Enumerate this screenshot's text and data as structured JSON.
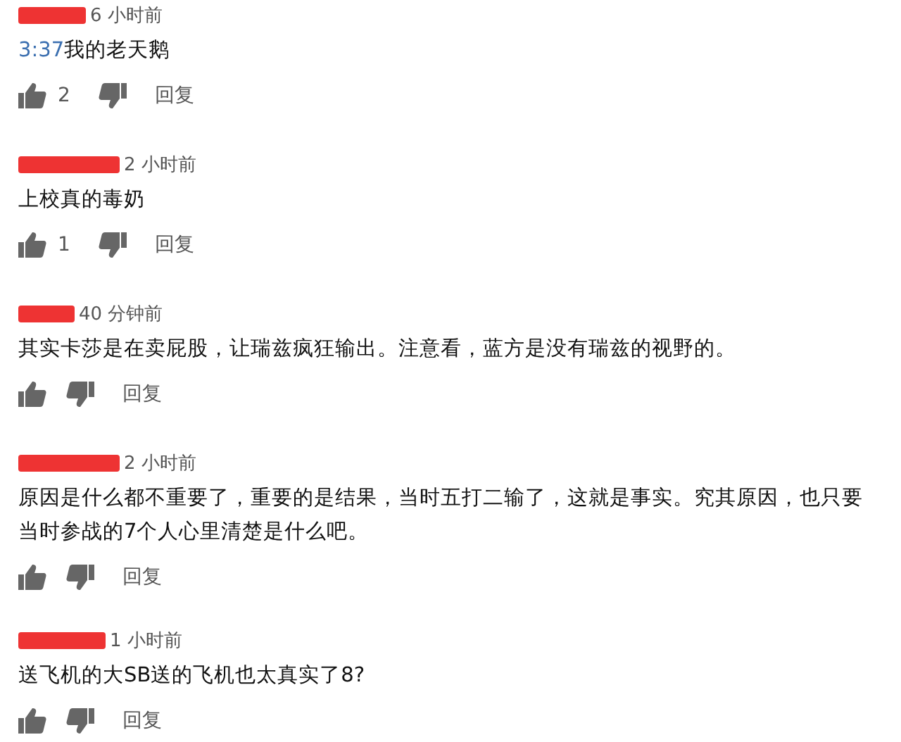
{
  "comments": [
    {
      "time": "6 小时前",
      "timestamp_link": "3:37",
      "text": "我的老天鹅",
      "likes": "2",
      "reply": "回复"
    },
    {
      "time": "2 小时前",
      "text": "上校真的毒奶",
      "likes": "1",
      "reply": "回复"
    },
    {
      "time": "40 分钟前",
      "text": "其实卡莎是在卖屁股，让瑞兹疯狂输出。注意看，蓝方是没有瑞兹的视野的。",
      "reply": "回复"
    },
    {
      "time": "2 小时前",
      "text": "原因是什么都不重要了，重要的是结果，当时五打二输了，这就是事实。究其原因，也只要当时参战的7个人心里清楚是什么吧。",
      "reply": "回复"
    },
    {
      "time": "1 小时前",
      "text": "送飞机的大SB送的飞机也太真实了8?",
      "reply": "回复"
    }
  ]
}
